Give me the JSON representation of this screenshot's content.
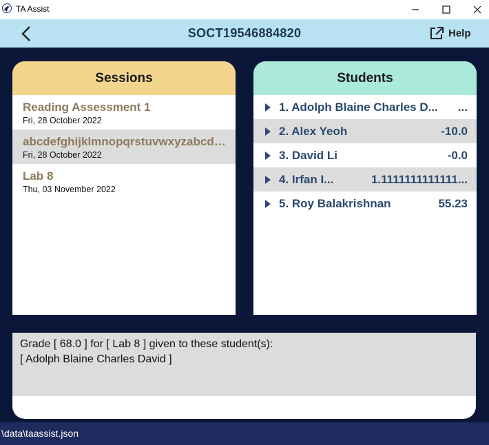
{
  "window": {
    "title": "TA Assist",
    "icons": {
      "minimize": "minimize-icon",
      "maximize": "maximize-icon",
      "close": "close-icon"
    }
  },
  "header": {
    "title": "SOCT19546884820",
    "help_label": "Help",
    "colors": {
      "background": "#b8e2f2",
      "title": "#1e3556"
    }
  },
  "sessions": {
    "heading": "Sessions",
    "items": [
      {
        "name": "Reading Assessment 1",
        "date": "Fri, 28 October 2022"
      },
      {
        "name": "abcdefghijklmnopqrstuvwxyzabcde...",
        "date": "Fri, 28 October 2022",
        "selected": true
      },
      {
        "name": "Lab 8",
        "date": "Thu, 03 November 2022"
      }
    ]
  },
  "students": {
    "heading": "Students",
    "items": [
      {
        "name": "1. Adolph Blaine Charles D...",
        "score": "..."
      },
      {
        "name": "2. Alex Yeoh",
        "score": "-10.0"
      },
      {
        "name": "3. David Li",
        "score": "-0.0"
      },
      {
        "name": "4. Irfan I...",
        "score": "1.1111111111111..."
      },
      {
        "name": "5. Roy Balakrishnan",
        "score": "55.23"
      }
    ]
  },
  "result": {
    "line1": "Grade [ 68.0 ] for [ Lab 8 ] given to these student(s):",
    "line2": "[ Adolph Blaine Charles David ]"
  },
  "status": {
    "path": "\\data\\taassist.json"
  },
  "colors": {
    "main_background": "#0b1739",
    "sessions_header": "#f4d58e",
    "students_header": "#abe9da",
    "session_text": "#8c7a5d",
    "student_text": "#2a4a6e",
    "statusbar": "#1d2b5e"
  }
}
